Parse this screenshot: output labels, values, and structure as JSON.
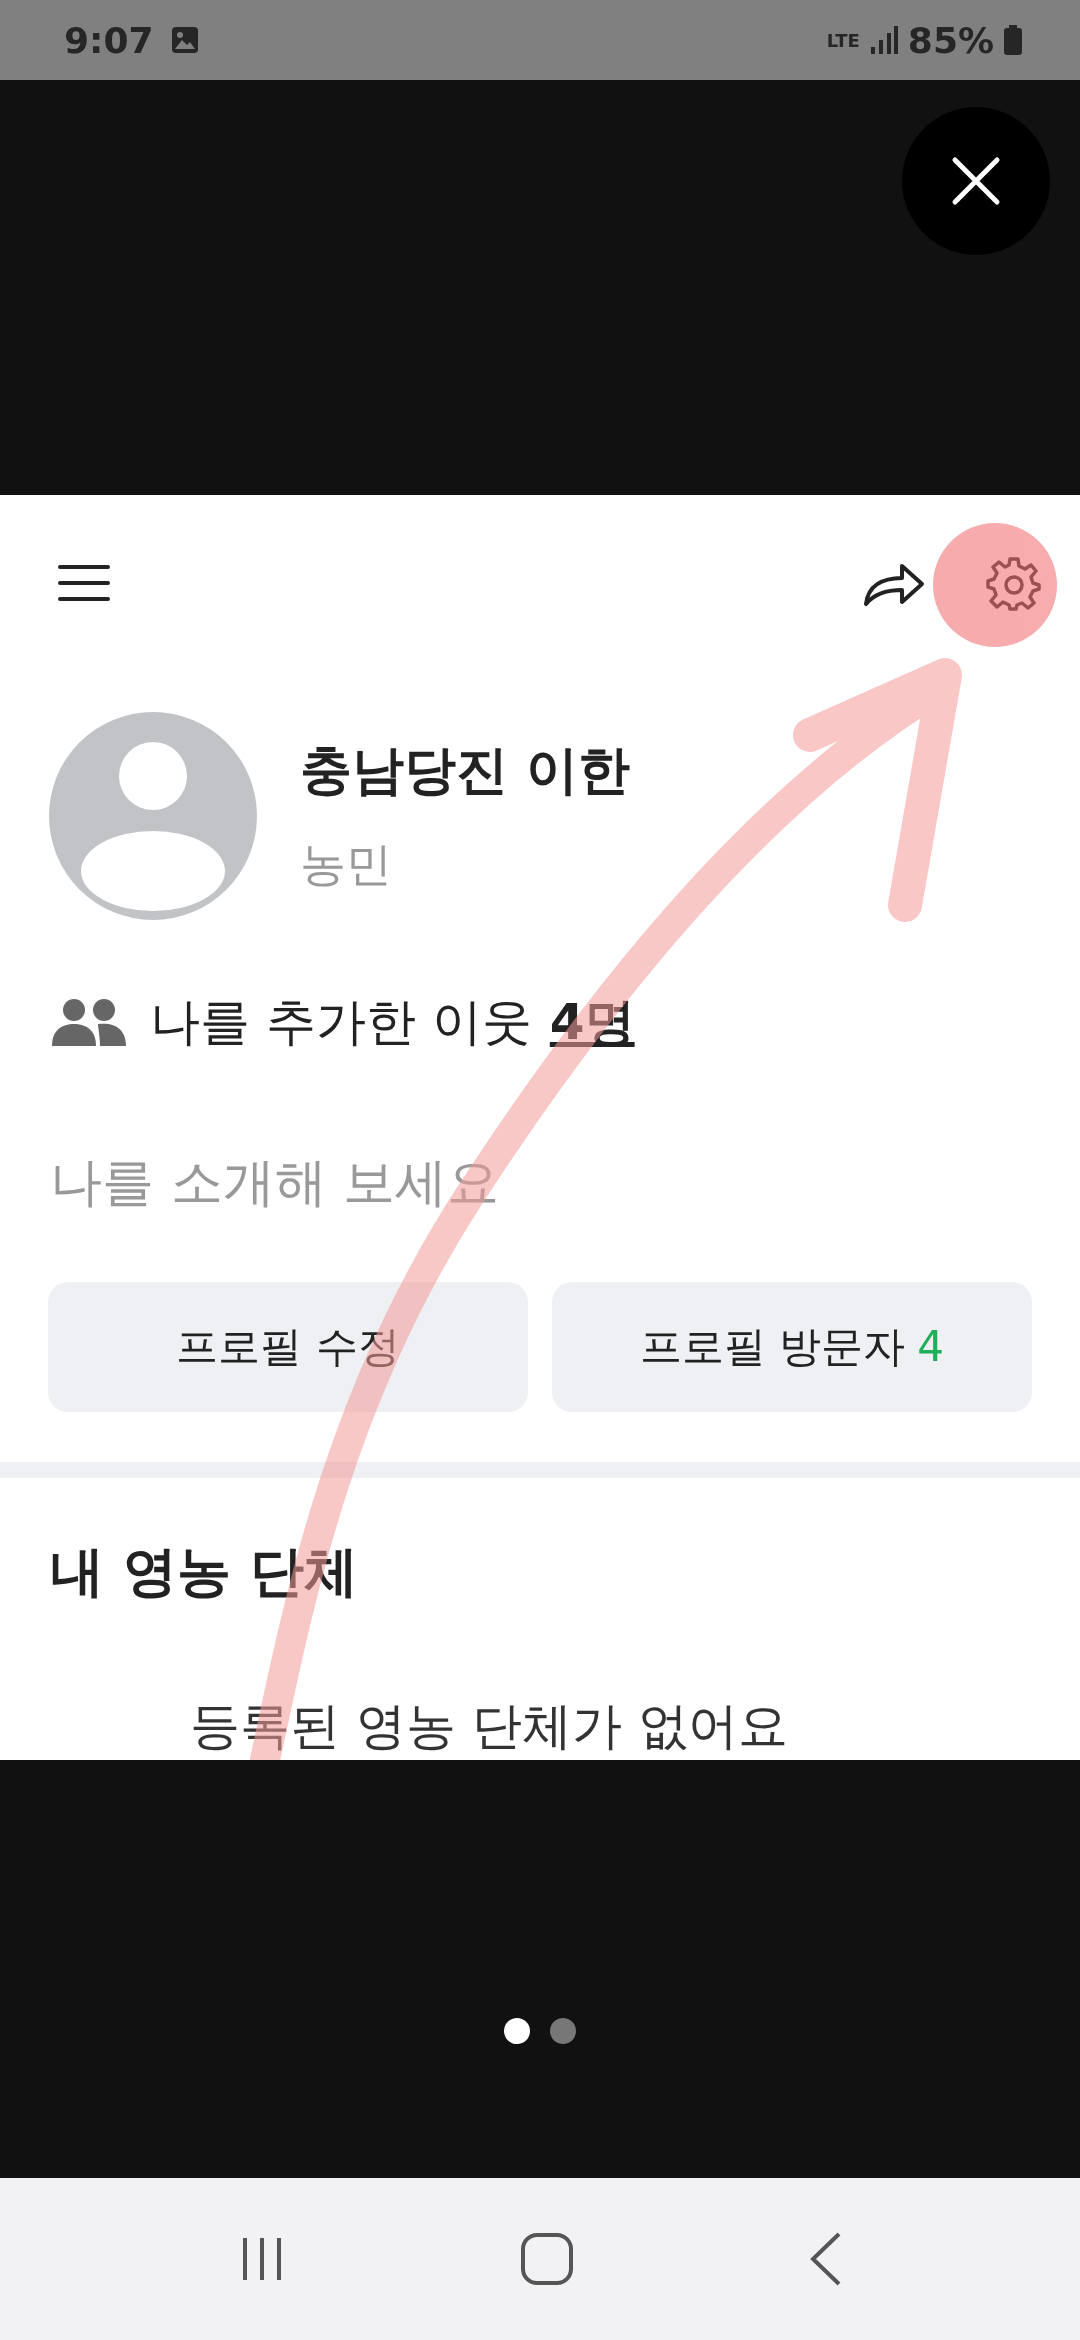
{
  "status_bar": {
    "time": "9:07",
    "network": "LTE",
    "battery": "85%"
  },
  "profile": {
    "name": "충남당진 이한",
    "role": "농민",
    "neighbors_label": "나를 추가한 이웃",
    "neighbors_count": "4명",
    "intro_placeholder": "나를 소개해 보세요",
    "buttons": [
      {
        "label": "프로필 수정"
      },
      {
        "label": "프로필 방문자",
        "count": "4"
      }
    ]
  },
  "section": {
    "title": "내 영농 단체",
    "empty_text": "등록된 영농 단체가 없어요"
  },
  "pager": [
    {
      "selected": true
    },
    {
      "selected": false
    }
  ]
}
